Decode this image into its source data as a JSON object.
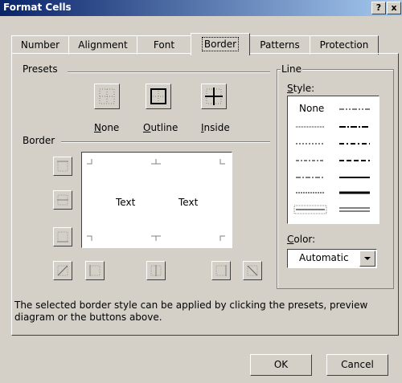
{
  "window": {
    "title": "Format Cells",
    "help_label": "?",
    "close_label": "x"
  },
  "tabs": [
    {
      "label": "Number"
    },
    {
      "label": "Alignment"
    },
    {
      "label": "Font"
    },
    {
      "label": "Border",
      "active": true
    },
    {
      "label": "Patterns"
    },
    {
      "label": "Protection"
    }
  ],
  "presets": {
    "heading": "Presets",
    "none": {
      "accel": "N",
      "rest": "one"
    },
    "outline": {
      "accel": "O",
      "rest": "utline"
    },
    "inside": {
      "accel": "I",
      "rest": "nside"
    }
  },
  "border": {
    "heading": "Border",
    "preview_texts": [
      "Text",
      "Text"
    ]
  },
  "line": {
    "heading": "Line",
    "style": {
      "accel": "S",
      "rest": "tyle:"
    },
    "style_none": "None",
    "color": {
      "accel": "C",
      "rest": "olor:"
    },
    "color_value": "Automatic"
  },
  "hint": {
    "line1": "The selected border style can be applied by clicking the presets, preview",
    "line2": "diagram or the buttons above."
  },
  "buttons": {
    "ok": "OK",
    "cancel": "Cancel"
  }
}
